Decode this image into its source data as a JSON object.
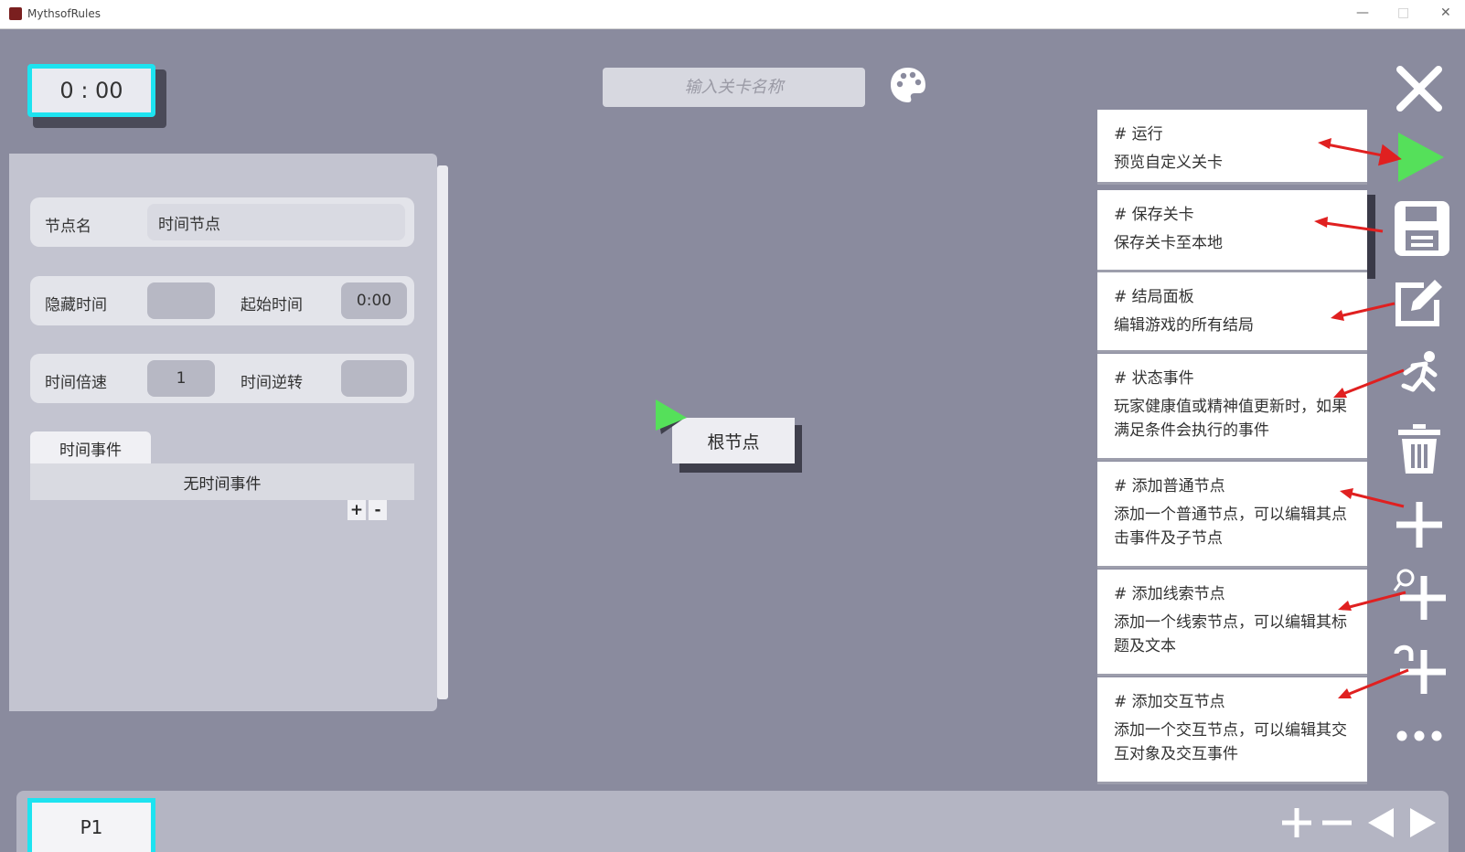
{
  "window": {
    "title": "MythsofRules"
  },
  "timer": {
    "value": "0 : 00"
  },
  "level_name": {
    "placeholder": "输入关卡名称"
  },
  "properties": {
    "node_name_label": "节点名",
    "node_name_value": "时间节点",
    "hide_time_label": "隐藏时间",
    "start_time_label": "起始时间",
    "start_time_value": "0:00",
    "time_speed_label": "时间倍速",
    "time_speed_value": "1",
    "time_reverse_label": "时间逆转",
    "events_tab": "时间事件",
    "events_empty": "无时间事件",
    "add_label": "+",
    "remove_label": "-"
  },
  "canvas": {
    "root_node": "根节点"
  },
  "tooltips": [
    {
      "title": "# 运行",
      "desc": "预览自定义关卡"
    },
    {
      "title": "# 保存关卡",
      "desc": "保存关卡至本地"
    },
    {
      "title": "# 结局面板",
      "desc": "编辑游戏的所有结局"
    },
    {
      "title": "# 状态事件",
      "desc": "玩家健康值或精神值更新时，如果满足条件会执行的事件"
    },
    {
      "title": "# 添加普通节点",
      "desc": "添加一个普通节点，可以编辑其点击事件及子节点"
    },
    {
      "title": "# 添加线索节点",
      "desc": "添加一个线索节点，可以编辑其标题及文本"
    },
    {
      "title": "# 添加交互节点",
      "desc": "添加一个交互节点，可以编辑其交互对象及交互事件"
    }
  ],
  "toolbar_icons": [
    "close-icon",
    "play-icon",
    "save-icon",
    "edit-icon",
    "running-person-icon",
    "trash-icon",
    "plus-icon",
    "clue-node-icon",
    "interact-node-icon",
    "more-icon"
  ],
  "pages": {
    "current": "P1"
  },
  "colors": {
    "accent": "#1de3f0",
    "play": "#55e05a",
    "arrow": "#e02020",
    "background": "#8a8b9e"
  }
}
